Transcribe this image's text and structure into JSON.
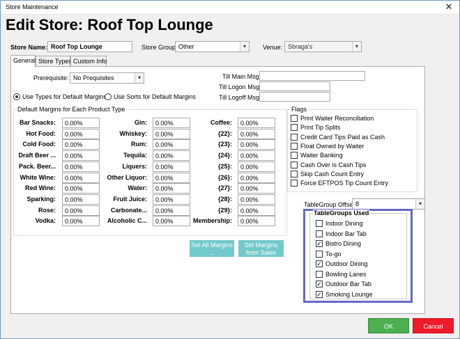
{
  "window": {
    "title": "Store  Maintenance",
    "close_glyph": "✕"
  },
  "heading": "Edit Store: Roof Top Lounge",
  "store_name": {
    "label": "Store Name:",
    "value": "Roof Top Lounge"
  },
  "store_group": {
    "label": "Store Group:",
    "value": "Other"
  },
  "venue": {
    "label": "Venue:",
    "value": "Sbraga's"
  },
  "tabs": [
    {
      "label": "General"
    },
    {
      "label": "Store Types"
    },
    {
      "label": "Custom Info"
    }
  ],
  "prerequisite": {
    "label": "Prerequisite:",
    "value": "No Prequisites"
  },
  "till": {
    "main_label": "Till Main Msg:",
    "main_value": "",
    "logon_label": "Till Logon Msg:",
    "logon_value": "",
    "logoff_label": "Till Logoff Msg:",
    "logoff_value": ""
  },
  "margin_mode": {
    "types_label": "Use Types for Default Margins",
    "sorts_label": "Use Sorts for Default Margins",
    "selected": "types"
  },
  "margins": {
    "group_title": "Default Margins for Each Product Type",
    "col1": [
      {
        "label": "Bar Snacks:",
        "value": "0.00%"
      },
      {
        "label": "Hot Food:",
        "value": "0.00%"
      },
      {
        "label": "Cold Food:",
        "value": "0.00%"
      },
      {
        "label": "Draft Beer ...",
        "value": "0.00%"
      },
      {
        "label": "Pack. Beer...",
        "value": "0.00%"
      },
      {
        "label": "White Wine:",
        "value": "0.00%"
      },
      {
        "label": "Red Wine:",
        "value": "0.00%"
      },
      {
        "label": "Sparking:",
        "value": "0.00%"
      },
      {
        "label": "Rose:",
        "value": "0.00%"
      },
      {
        "label": "Vodka:",
        "value": "0.00%"
      }
    ],
    "col2": [
      {
        "label": "Gin:",
        "value": "0.00%"
      },
      {
        "label": "Whiskey:",
        "value": "0.00%"
      },
      {
        "label": "Rum:",
        "value": "0.00%"
      },
      {
        "label": "Tequila:",
        "value": "0.00%"
      },
      {
        "label": "Liquers:",
        "value": "0.00%"
      },
      {
        "label": "Other Liquor:",
        "value": "0.00%"
      },
      {
        "label": "Water:",
        "value": "0.00%"
      },
      {
        "label": "Fruit Juice:",
        "value": "0.00%"
      },
      {
        "label": "Carbonate...",
        "value": "0.00%"
      },
      {
        "label": "Alcoholic C...",
        "value": "0.00%"
      }
    ],
    "col3": [
      {
        "label": "Coffee:",
        "value": "0.00%"
      },
      {
        "label": "{22}:",
        "value": "0.00%"
      },
      {
        "label": "{23}:",
        "value": "0.00%"
      },
      {
        "label": "{24}:",
        "value": "0.00%"
      },
      {
        "label": "{25}:",
        "value": "0.00%"
      },
      {
        "label": "{26}:",
        "value": "0.00%"
      },
      {
        "label": "{27}:",
        "value": "0.00%"
      },
      {
        "label": "{28}:",
        "value": "0.00%"
      },
      {
        "label": "{29}:",
        "value": "0.00%"
      },
      {
        "label": "Membership:",
        "value": "0.00%"
      }
    ],
    "set_all_label": "Set All Margins ...",
    "set_from_sales_label": "Set Margins from Sales"
  },
  "flags": {
    "title": "Flags",
    "items": [
      {
        "label": "Print Waiter Reconciliation",
        "checked": false
      },
      {
        "label": "Print Tip Splits",
        "checked": false
      },
      {
        "label": "Credit Card Tips Paid as Cash",
        "checked": false
      },
      {
        "label": "Float Owned by Waiter",
        "checked": false
      },
      {
        "label": "Waiter Banking",
        "checked": false
      },
      {
        "label": "Cash Over is Cash Tips",
        "checked": false
      },
      {
        "label": "Skip Cash Count Entry",
        "checked": false
      },
      {
        "label": "Force EFTPOS Tip Count Entry",
        "checked": false
      }
    ]
  },
  "tablegroup_offset": {
    "label": "TableGroup Offset:",
    "value": "8"
  },
  "tablegroups": {
    "title": "TableGroups Used",
    "items": [
      {
        "label": "Indoor Dining",
        "checked": false
      },
      {
        "label": "Indoor Bar Tab",
        "checked": false
      },
      {
        "label": "Bistro Dining",
        "checked": true
      },
      {
        "label": "To-go",
        "checked": false
      },
      {
        "label": "Outdoor Dining",
        "checked": true
      },
      {
        "label": "Bowling Lanes",
        "checked": false
      },
      {
        "label": "Outdoor Bar Tab",
        "checked": true
      },
      {
        "label": "Smoking Lounge",
        "checked": true
      }
    ]
  },
  "buttons": {
    "ok": "OK",
    "cancel": "Cancel"
  },
  "colors": {
    "ok": "#4caf50",
    "cancel": "#ef1b2a",
    "teal_buttons": "#72c9cb",
    "highlight_border": "#6667c8"
  }
}
